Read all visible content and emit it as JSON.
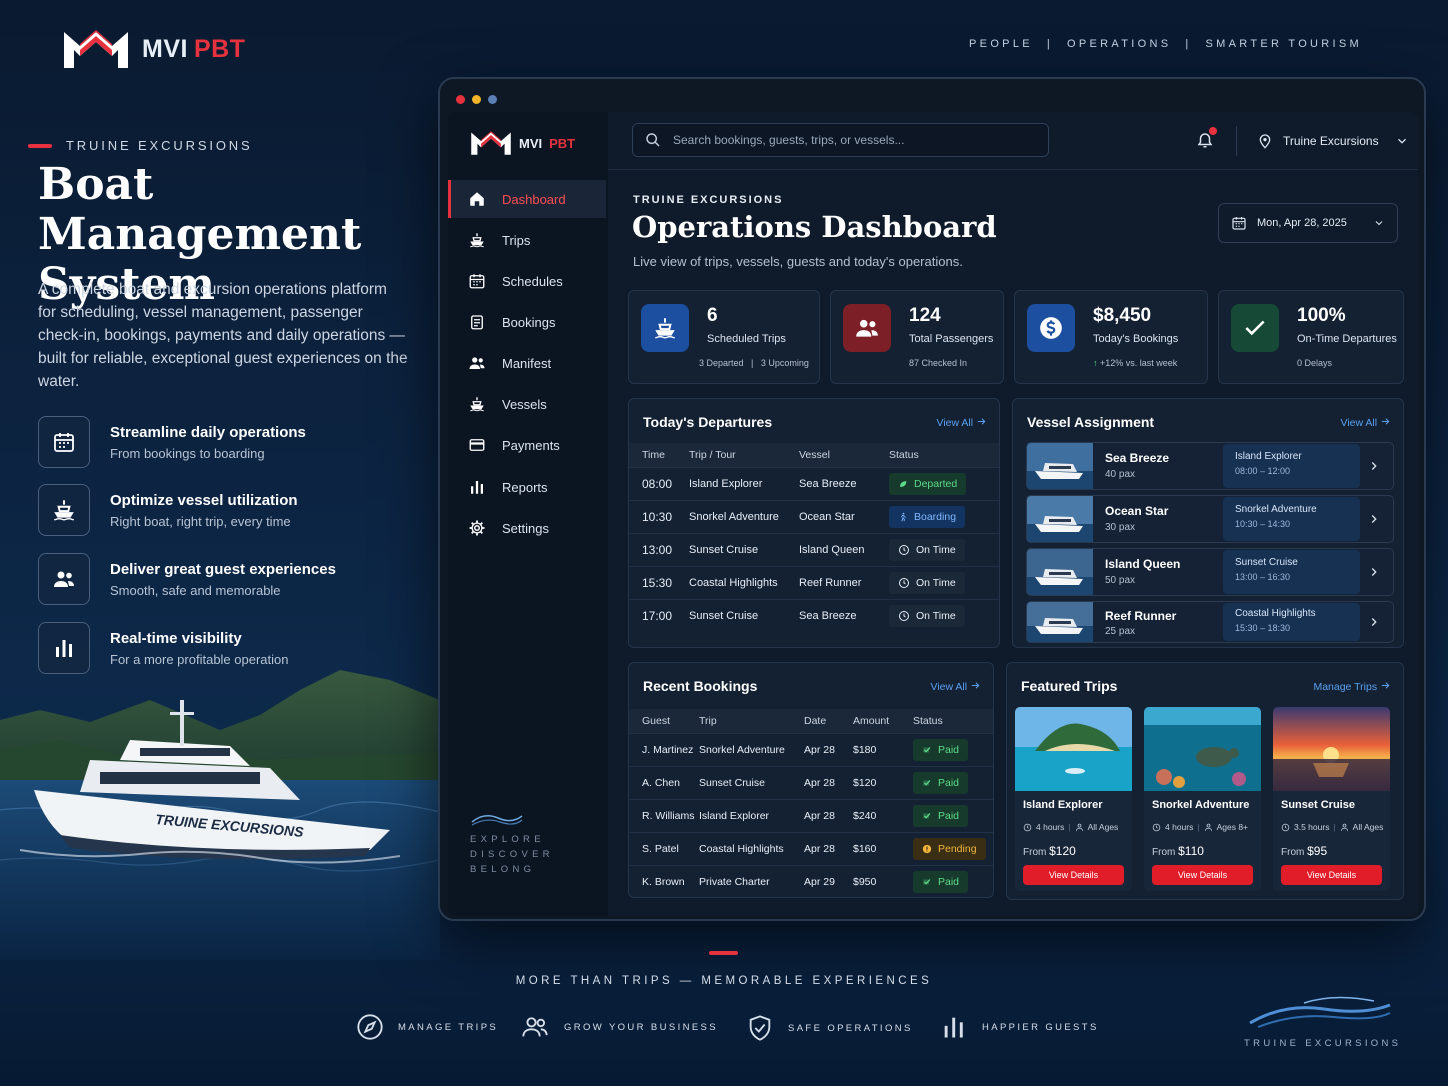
{
  "brand": {
    "mark_left": "MVI",
    "mark_right": "PBT"
  },
  "tagline": {
    "items": [
      "PEOPLE",
      "OPERATIONS",
      "SMARTER TOURISM"
    ],
    "sep": "|"
  },
  "hero": {
    "eyebrow": "TRUINE EXCURSIONS",
    "title": "Boat Management System",
    "description": "A complete boat and excursion operations platform for scheduling, vessel management, passenger check-in, bookings, payments and daily operations — built for reliable, exceptional guest experiences on the water.",
    "features": [
      {
        "title": "Streamline daily operations",
        "subtitle": "From bookings to boarding",
        "icon": "calendar-icon"
      },
      {
        "title": "Optimize vessel utilization",
        "subtitle": "Right boat, right trip, every time",
        "icon": "ship-icon"
      },
      {
        "title": "Deliver great guest experiences",
        "subtitle": "Smooth, safe and memorable",
        "icon": "users-icon"
      },
      {
        "title": "Real-time visibility",
        "subtitle": "For a more profitable operation",
        "icon": "bar-chart-icon"
      }
    ],
    "boat_hull_text": "TRUINE EXCURSIONS"
  },
  "app": {
    "logo": {
      "left": "MVI",
      "right": "PBT"
    },
    "nav": [
      {
        "label": "Dashboard",
        "icon": "home-icon",
        "active": true
      },
      {
        "label": "Trips",
        "icon": "ship-icon"
      },
      {
        "label": "Schedules",
        "icon": "calendar-icon"
      },
      {
        "label": "Bookings",
        "icon": "clipboard-icon"
      },
      {
        "label": "Manifest",
        "icon": "users-icon"
      },
      {
        "label": "Vessels",
        "icon": "ship-icon"
      },
      {
        "label": "Payments",
        "icon": "credit-card-icon"
      },
      {
        "label": "Reports",
        "icon": "bar-chart-icon"
      },
      {
        "label": "Settings",
        "icon": "gear-icon"
      }
    ],
    "side_motto": [
      "EXPLORE",
      "DISCOVER",
      "BELONG"
    ],
    "search_placeholder": "Search bookings, guests, trips, or vessels...",
    "org_name": "Truine Excursions",
    "kicker": "TRUINE EXCURSIONS",
    "title": "Operations Dashboard",
    "subtitle": "Live view of trips, vessels, guests and today's operations.",
    "date": "Mon, Apr 28, 2025",
    "stats": [
      {
        "value": "6",
        "label": "Scheduled Trips",
        "sub": "3 Departed   |   3 Upcoming",
        "icon": "ship-icon",
        "color": "#1d4fa0"
      },
      {
        "value": "124",
        "label": "Total Passengers",
        "sub": "87 Checked In",
        "icon": "users-icon",
        "color": "#7d1f26"
      },
      {
        "value": "$8,450",
        "label": "Today's Bookings",
        "sub": "+12% vs. last week",
        "icon": "dollar-icon",
        "color": "#1d4fa0"
      },
      {
        "value": "100%",
        "label": "On-Time Departures",
        "sub": "0 Delays",
        "icon": "check-icon",
        "color": "#174a36"
      }
    ],
    "departures": {
      "title": "Today's Departures",
      "view_all": "View All",
      "columns": [
        "Time",
        "Trip / Tour",
        "Vessel",
        "Status"
      ],
      "rows": [
        {
          "time": "08:00",
          "trip": "Island Explorer",
          "vessel": "Sea Breeze",
          "status": "Departed",
          "kind": "dep"
        },
        {
          "time": "10:30",
          "trip": "Snorkel Adventure",
          "vessel": "Ocean Star",
          "status": "Boarding",
          "kind": "brd"
        },
        {
          "time": "13:00",
          "trip": "Sunset Cruise",
          "vessel": "Island Queen",
          "status": "On Time",
          "kind": "on"
        },
        {
          "time": "15:30",
          "trip": "Coastal Highlights",
          "vessel": "Reef Runner",
          "status": "On Time",
          "kind": "on"
        },
        {
          "time": "17:00",
          "trip": "Sunset Cruise",
          "vessel": "Sea Breeze",
          "status": "On Time",
          "kind": "on"
        }
      ]
    },
    "vessels": {
      "title": "Vessel Assignment",
      "view_all": "View All",
      "rows": [
        {
          "name": "Sea Breeze",
          "pax": "40 pax",
          "trip": "Island Explorer",
          "time": "08:00 – 12:00"
        },
        {
          "name": "Ocean Star",
          "pax": "30 pax",
          "trip": "Snorkel Adventure",
          "time": "10:30 – 14:30"
        },
        {
          "name": "Island Queen",
          "pax": "50 pax",
          "trip": "Sunset Cruise",
          "time": "13:00 – 16:30"
        },
        {
          "name": "Reef Runner",
          "pax": "25 pax",
          "trip": "Coastal Highlights",
          "time": "15:30 – 18:30"
        }
      ]
    },
    "bookings": {
      "title": "Recent Bookings",
      "view_all": "View All",
      "columns": [
        "Guest",
        "Trip",
        "Date",
        "Amount",
        "Status"
      ],
      "rows": [
        {
          "guest": "J. Martinez",
          "trip": "Snorkel Adventure",
          "date": "Apr 28",
          "amount": "$180",
          "status": "Paid",
          "kind": "paid"
        },
        {
          "guest": "A. Chen",
          "trip": "Sunset Cruise",
          "date": "Apr 28",
          "amount": "$120",
          "status": "Paid",
          "kind": "paid"
        },
        {
          "guest": "R. Williams",
          "trip": "Island Explorer",
          "date": "Apr 28",
          "amount": "$240",
          "status": "Paid",
          "kind": "paid"
        },
        {
          "guest": "S. Patel",
          "trip": "Coastal Highlights",
          "date": "Apr 28",
          "amount": "$160",
          "status": "Pending",
          "kind": "pend"
        },
        {
          "guest": "K. Brown",
          "trip": "Private Charter",
          "date": "Apr 29",
          "amount": "$950",
          "status": "Paid",
          "kind": "paid"
        }
      ]
    },
    "featured": {
      "title": "Featured Trips",
      "manage": "Manage Trips",
      "items": [
        {
          "name": "Island Explorer",
          "duration": "4 hours",
          "ages": "All Ages",
          "from": "From",
          "price": "$120",
          "button": "View Details"
        },
        {
          "name": "Snorkel Adventure",
          "duration": "4 hours",
          "ages": "Ages 8+",
          "from": "From",
          "price": "$110",
          "button": "View Details"
        },
        {
          "name": "Sunset Cruise",
          "duration": "3.5 hours",
          "ages": "All Ages",
          "from": "From",
          "price": "$95",
          "button": "View Details"
        }
      ]
    }
  },
  "bottom": {
    "tagline": "MORE THAN TRIPS — MEMORABLE EXPERIENCES",
    "items": [
      {
        "label": "MANAGE TRIPS",
        "icon": "compass-icon"
      },
      {
        "label": "GROW YOUR BUSINESS",
        "icon": "users-icon"
      },
      {
        "label": "SAFE OPERATIONS",
        "icon": "shield-check-icon"
      },
      {
        "label": "HAPPIER GUESTS",
        "icon": "bar-chart-icon"
      }
    ],
    "footer_mark": "TRUINE EXCURSIONS"
  },
  "colors": {
    "accent": "#e6323e",
    "link": "#5aa0f0",
    "panel": "#142133"
  }
}
